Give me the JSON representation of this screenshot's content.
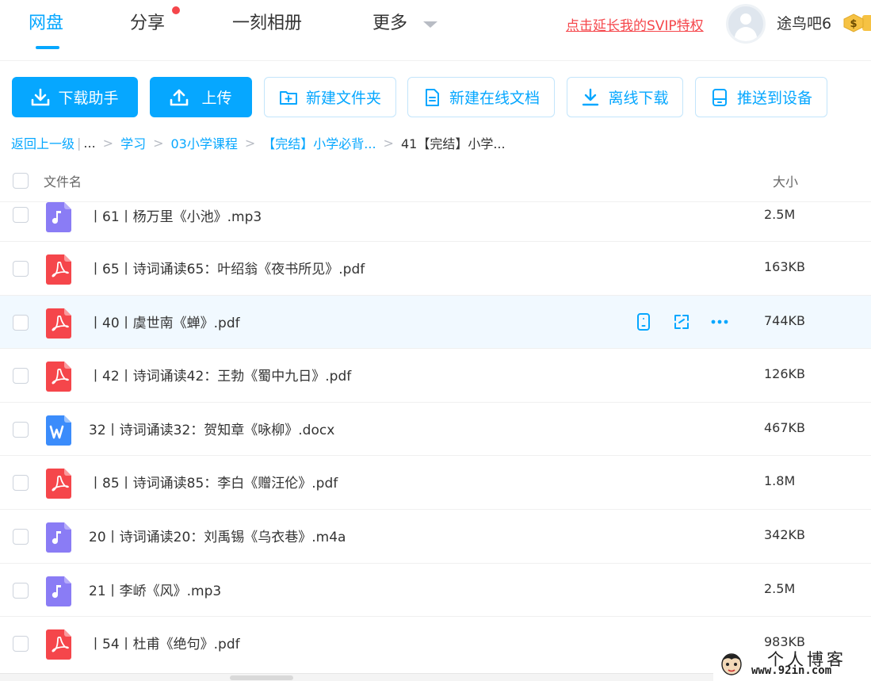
{
  "nav": {
    "tabs": [
      {
        "label": "网盘",
        "active": true
      },
      {
        "label": "分享",
        "active": false,
        "has_dot": true
      },
      {
        "label": "一刻相册",
        "active": false
      },
      {
        "label": "更多",
        "active": false,
        "has_caret": true
      }
    ],
    "svip_link": "点击延长我的SVIP特权",
    "username": "途鸟吧6",
    "coin_symbol": "$"
  },
  "toolbar": {
    "download_helper": "下载助手",
    "upload": "上传",
    "new_folder": "新建文件夹",
    "new_online_doc": "新建在线文档",
    "offline_download": "离线下载",
    "push_to_device": "推送到设备"
  },
  "breadcrumb": {
    "back": "返回上一级",
    "ellipsis": "...",
    "items": [
      "学习",
      "03小学课程",
      "【完结】小学必背...",
      "41【完结】小学..."
    ]
  },
  "list": {
    "header": {
      "name": "文件名",
      "size": "大小"
    },
    "files": [
      {
        "name": "丨61丨杨万里《小池》.mp3",
        "size": "2.5M",
        "type": "audio"
      },
      {
        "name": "丨65丨诗词诵读65：叶绍翁《夜书所见》.pdf",
        "size": "163KB",
        "type": "pdf"
      },
      {
        "name": "丨40丨虞世南《蝉》.pdf",
        "size": "744KB",
        "type": "pdf",
        "hover": true
      },
      {
        "name": "丨42丨诗词诵读42：王勃《蜀中九日》.pdf",
        "size": "126KB",
        "type": "pdf"
      },
      {
        "name": "32丨诗词诵读32：贺知章《咏柳》.docx",
        "size": "467KB",
        "type": "word"
      },
      {
        "name": "丨85丨诗词诵读85：李白《赠汪伦》.pdf",
        "size": "1.8M",
        "type": "pdf"
      },
      {
        "name": "20丨诗词诵读20：刘禹锡《乌衣巷》.m4a",
        "size": "342KB",
        "type": "audio"
      },
      {
        "name": "21丨李峤《风》.mp3",
        "size": "2.5M",
        "type": "audio"
      },
      {
        "name": "丨54丨杜甫《绝句》.pdf",
        "size": "983KB",
        "type": "pdf"
      }
    ]
  },
  "watermark": {
    "title": "个人博客",
    "url": "www.92in.com"
  },
  "colors": {
    "accent": "#06a7ff",
    "svip_red": "#f5464b",
    "pdf_red": "#f5464b",
    "audio_purple": "#8a7cf5",
    "word_blue": "#3b8cfb",
    "hover_row": "#f1f9ff"
  }
}
